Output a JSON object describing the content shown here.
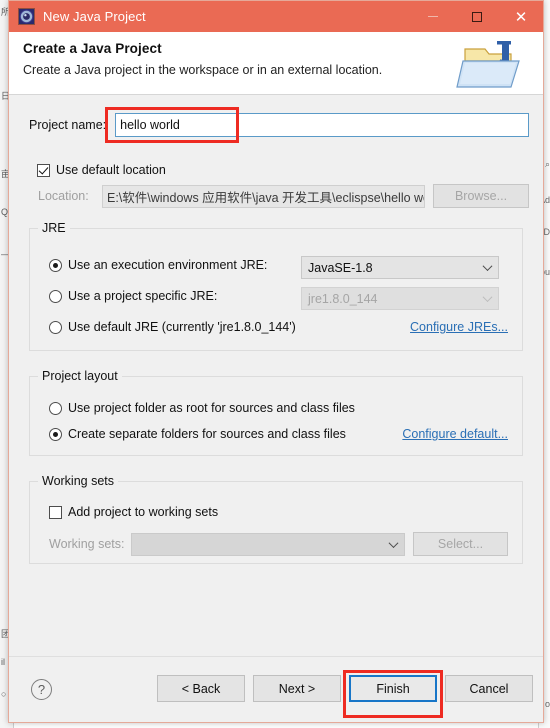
{
  "window": {
    "title": "New Java Project",
    "icon": "java-project-icon",
    "titlebar_color": "#ea6a54",
    "controls": [
      {
        "name": "minimize-button",
        "glyph": "minimize-icon"
      },
      {
        "name": "maximize-button",
        "glyph": "maximize-icon"
      },
      {
        "name": "close-button",
        "glyph": "close-icon"
      }
    ]
  },
  "header": {
    "title": "Create a Java Project",
    "subtitle": "Create a Java project in the workspace or in an external location.",
    "icon": "java-folder-wizard-icon"
  },
  "project_name": {
    "label": "Project name:",
    "value": "hello world",
    "placeholder": "",
    "highlighted": true,
    "highlight_color": "#ee2b22"
  },
  "location": {
    "use_default_label": "Use default location",
    "use_default_checked": true,
    "label": "Location:",
    "value": "E:\\软件\\windows 应用软件\\java 开发工具\\eclispse\\hello wo",
    "browse_label": "Browse...",
    "browse_enabled": false
  },
  "jre": {
    "legend": "JRE",
    "options": [
      {
        "name": "use-execution-environment-jre",
        "label": "Use an execution environment JRE:",
        "selected": true,
        "combo_value": "JavaSE-1.8",
        "combo_enabled": true
      },
      {
        "name": "use-project-specific-jre",
        "label": "Use a project specific JRE:",
        "selected": false,
        "combo_value": "jre1.8.0_144",
        "combo_enabled": false
      },
      {
        "name": "use-default-jre",
        "label": "Use default JRE (currently 'jre1.8.0_144')",
        "selected": false
      }
    ],
    "configure_link": "Configure JREs..."
  },
  "project_layout": {
    "legend": "Project layout",
    "options": [
      {
        "name": "project-folder-as-root",
        "label": "Use project folder as root for sources and class files",
        "selected": false
      },
      {
        "name": "separate-folders",
        "label": "Create separate folders for sources and class files",
        "selected": true
      }
    ],
    "configure_link": "Configure default..."
  },
  "working_sets": {
    "legend": "Working sets",
    "add_label": "Add project to working sets",
    "add_checked": false,
    "label": "Working sets:",
    "value": "",
    "select_label": "Select...",
    "select_enabled": false
  },
  "footer": {
    "help_icon": "help-icon",
    "buttons": [
      {
        "name": "back-button",
        "label": "< Back",
        "focused": false,
        "annotated": false
      },
      {
        "name": "next-button",
        "label": "Next >",
        "focused": false,
        "annotated": false
      },
      {
        "name": "finish-button",
        "label": "Finish",
        "focused": true,
        "annotated": true
      },
      {
        "name": "cancel-button",
        "label": "Cancel",
        "focused": false,
        "annotated": false
      }
    ],
    "annotation_color": "#ee2b22",
    "focus_color": "#1876c8"
  },
  "background": {
    "left_glyphs": [
      "所",
      "日",
      "亩",
      "Q",
      "—",
      "团",
      "il",
      "○"
    ],
    "right_glyphs": [
      "⌕",
      "Ad",
      "D",
      "ou",
      "o"
    ]
  }
}
